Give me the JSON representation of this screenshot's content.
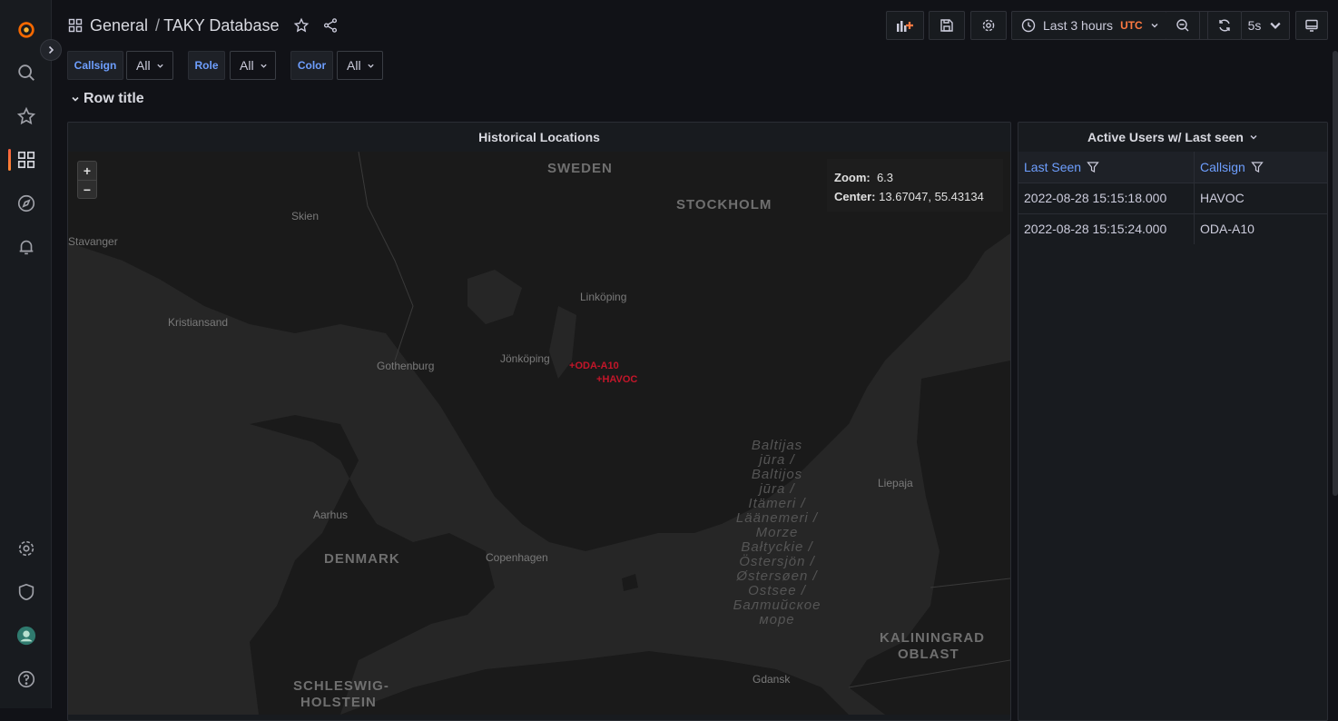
{
  "breadcrumb": {
    "folder": "General",
    "separator": "/",
    "dashboard": "TAKY Database"
  },
  "toolbar": {
    "time_range": "Last 3 hours",
    "timezone": "UTC",
    "refresh_interval": "5s"
  },
  "variables": [
    {
      "label": "Callsign",
      "value": "All"
    },
    {
      "label": "Role",
      "value": "All"
    },
    {
      "label": "Color",
      "value": "All"
    }
  ],
  "row": {
    "title": "Row title"
  },
  "map_panel": {
    "title": "Historical Locations",
    "zoom_label": "Zoom:",
    "zoom_value": "6.3",
    "center_label": "Center:",
    "center_value": "13.67047, 55.43134",
    "zoom_in": "+",
    "zoom_out": "−",
    "markers": [
      "ODA-A10",
      "HAVOC"
    ],
    "places": {
      "sweden": "SWEDEN",
      "stockholm": "STOCKHOLM",
      "skien": "Skien",
      "stavanger": "Stavanger",
      "kristiansand": "Kristiansand",
      "linkoping": "Linköping",
      "jonkoping": "Jönköping",
      "gothenburg": "Gothenburg",
      "aarhus": "Aarhus",
      "denmark": "DENMARK",
      "copenhagen": "Copenhagen",
      "liepaja": "Liepaja",
      "kaliningrad1": "KALININGRAD",
      "kaliningrad2": "OBLAST",
      "gdansk": "Gdansk",
      "schleswig1": "SCHLESWIG-",
      "schleswig2": "HOLSTEIN",
      "sea": [
        "Baltijas",
        "jūra /",
        "Baltijos",
        "jūra /",
        "Itämeri /",
        "Läänemeri /",
        "Morze",
        "Bałtyckie /",
        "Östersjön /",
        "Østersøen /",
        "Ostsee /",
        "Балтийское",
        "море"
      ]
    }
  },
  "users_panel": {
    "title": "Active Users w/ Last seen",
    "columns": [
      "Last Seen",
      "Callsign"
    ],
    "rows": [
      [
        "2022-08-28 15:15:18.000",
        "HAVOC"
      ],
      [
        "2022-08-28 15:15:24.000",
        "ODA-A10"
      ]
    ]
  },
  "colors": {
    "accent": "#6e9fff",
    "marker": "#c4162a",
    "utc": "#ff7941"
  }
}
